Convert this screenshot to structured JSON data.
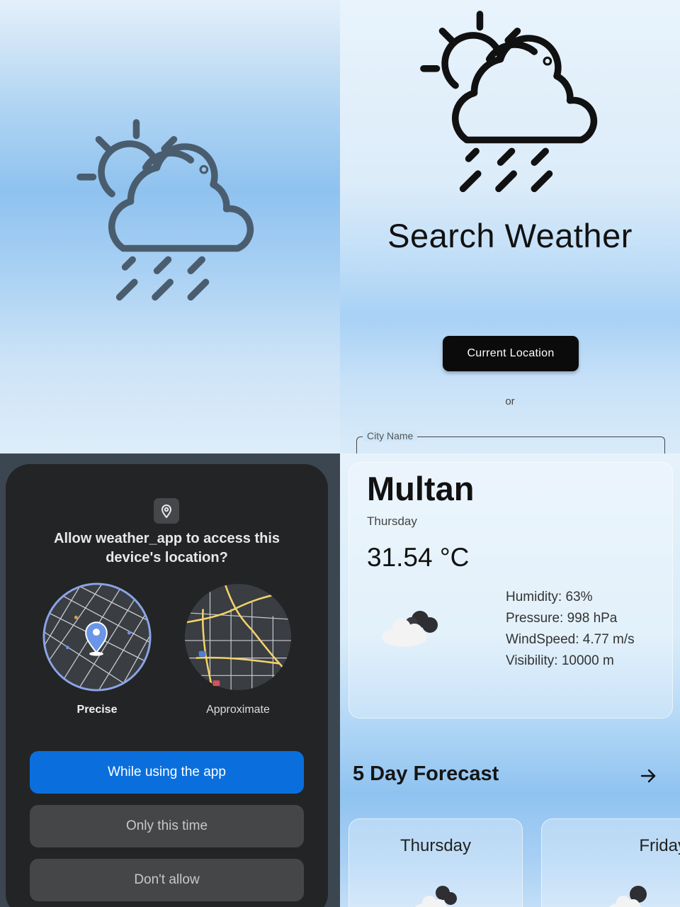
{
  "splash": {
    "icon": "sun-behind-rain-cloud-icon",
    "colors": {
      "bg_mid": "#8fc2ef",
      "icon_stroke": "#4a5d6e"
    }
  },
  "search": {
    "title": "Search Weather",
    "current_location_label": "Current Location",
    "or_label": "or",
    "city_field_label": "City Name",
    "colors": {
      "button_bg": "#0b0b0b"
    }
  },
  "permission": {
    "title": "Allow weather_app to access this device's location?",
    "options": [
      {
        "label": "Precise",
        "icon": "precise-map-icon",
        "selected": true
      },
      {
        "label": "Approximate",
        "icon": "approximate-map-icon",
        "selected": false
      }
    ],
    "buttons": {
      "while_using": "While using the app",
      "only_this_time": "Only this time",
      "dont_allow": "Don't allow"
    },
    "colors": {
      "dialog_bg": "#232425",
      "primary_button": "#0a6fdd"
    }
  },
  "result": {
    "city": "Multan",
    "day": "Thursday",
    "temperature": "31.54 °C",
    "condition_icon": "cloud-icon",
    "stats": {
      "humidity": "Humidity: 63%",
      "pressure": "Pressure: 998 hPa",
      "wind": "WindSpeed: 4.77 m/s",
      "visibility": "Visibility: 10000 m"
    },
    "forecast_title": "5 Day Forecast",
    "forecast_days": [
      {
        "day": "Thursday",
        "icon": "cloud-icon"
      },
      {
        "day": "Friday",
        "icon": "cloud-icon"
      }
    ]
  }
}
